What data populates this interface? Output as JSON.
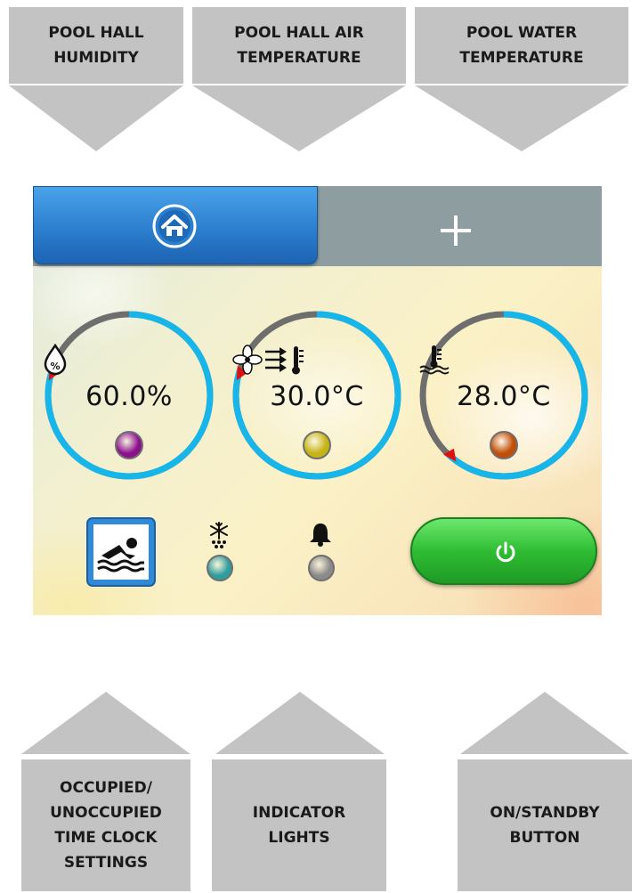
{
  "top_callouts": [
    {
      "line1": "POOL HALL",
      "line2": "HUMIDITY"
    },
    {
      "line1": "POOL HALL AIR",
      "line2": "TEMPERATURE"
    },
    {
      "line1": "POOL WATER",
      "line2": "TEMPERATURE"
    }
  ],
  "bottom_callouts": [
    {
      "lines": [
        "OCCUPIED/",
        "UNOCCUPIED",
        "TIME CLOCK",
        "SETTINGS"
      ]
    },
    {
      "lines": [
        "INDICATOR",
        "LIGHTS"
      ]
    },
    {
      "lines": [
        "ON/STANDBY",
        "BUTTON"
      ]
    }
  ],
  "screen": {
    "home_icon": "home-icon",
    "add_icon": "plus-icon",
    "gauges": [
      {
        "name": "humidity",
        "value": "60.0%",
        "icon": "humidity-drop-icon",
        "lamp_color": "#8c0f8e",
        "fill_fraction": 0.8
      },
      {
        "name": "air-temperature",
        "value": "30.0°C",
        "icon": "fan-thermometer-icon",
        "lamp_color": "#c6b314",
        "fill_fraction": 0.8
      },
      {
        "name": "water-temperature",
        "value": "28.0°C",
        "icon": "water-thermometer-icon",
        "lamp_color": "#c14d07",
        "fill_fraction": 0.62
      }
    ],
    "indicators": [
      {
        "name": "frost",
        "icon": "snowflake-icon",
        "lamp_color": "#2f9c9d"
      },
      {
        "name": "alarm",
        "icon": "bell-icon",
        "lamp_color": "#8a8a8a"
      }
    ],
    "occupancy_icon": "swimmer-icon",
    "power_icon": "power-icon",
    "colors": {
      "arc_active": "#16b6ea",
      "arc_track": "#6e6e6e",
      "marker": "#e01010"
    }
  }
}
